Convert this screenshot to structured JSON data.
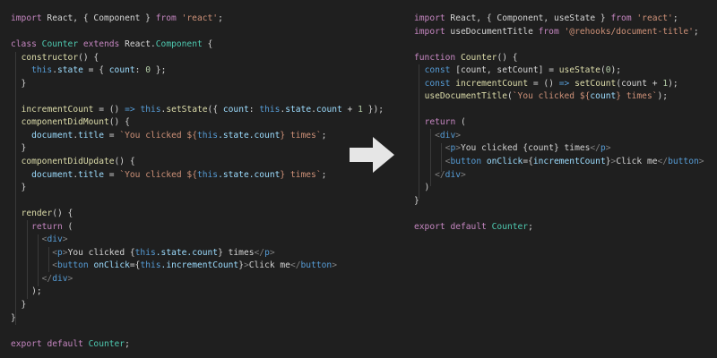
{
  "left_code": {
    "lines": [
      [
        {
          "t": "import",
          "c": "kw"
        },
        {
          "t": " React, { Component } "
        },
        {
          "t": "from",
          "c": "kw"
        },
        {
          "t": " "
        },
        {
          "t": "'react'",
          "c": "st"
        },
        {
          "t": ";"
        }
      ],
      [],
      [
        {
          "t": "class",
          "c": "kw"
        },
        {
          "t": " "
        },
        {
          "t": "Counter",
          "c": "cls"
        },
        {
          "t": " "
        },
        {
          "t": "extends",
          "c": "kw"
        },
        {
          "t": " React."
        },
        {
          "t": "Component",
          "c": "cls"
        },
        {
          "t": " {"
        }
      ],
      [
        {
          "t": "  "
        },
        {
          "t": "constructor",
          "c": "fn"
        },
        {
          "t": "() {"
        }
      ],
      [
        {
          "t": "    "
        },
        {
          "t": "this",
          "c": "th"
        },
        {
          "t": "."
        },
        {
          "t": "state",
          "c": "var"
        },
        {
          "t": " = { "
        },
        {
          "t": "count",
          "c": "var"
        },
        {
          "t": ": "
        },
        {
          "t": "0",
          "c": "num"
        },
        {
          "t": " };"
        }
      ],
      [
        {
          "t": "  }"
        }
      ],
      [],
      [
        {
          "t": "  "
        },
        {
          "t": "incrementCount",
          "c": "fn"
        },
        {
          "t": " = () "
        },
        {
          "t": "=>",
          "c": "th"
        },
        {
          "t": " "
        },
        {
          "t": "this",
          "c": "th"
        },
        {
          "t": "."
        },
        {
          "t": "setState",
          "c": "fn"
        },
        {
          "t": "({ "
        },
        {
          "t": "count",
          "c": "var"
        },
        {
          "t": ": "
        },
        {
          "t": "this",
          "c": "th"
        },
        {
          "t": "."
        },
        {
          "t": "state",
          "c": "var"
        },
        {
          "t": "."
        },
        {
          "t": "count",
          "c": "var"
        },
        {
          "t": " + "
        },
        {
          "t": "1",
          "c": "num"
        },
        {
          "t": " });"
        }
      ],
      [
        {
          "t": "  "
        },
        {
          "t": "componentDidMount",
          "c": "fn"
        },
        {
          "t": "() {"
        }
      ],
      [
        {
          "t": "    "
        },
        {
          "t": "document",
          "c": "var"
        },
        {
          "t": "."
        },
        {
          "t": "title",
          "c": "var"
        },
        {
          "t": " = "
        },
        {
          "t": "`You clicked ${",
          "c": "st"
        },
        {
          "t": "this",
          "c": "th"
        },
        {
          "t": ".state.count",
          "c": "var"
        },
        {
          "t": "} times`",
          "c": "st"
        },
        {
          "t": ";"
        }
      ],
      [
        {
          "t": "  }"
        }
      ],
      [
        {
          "t": "  "
        },
        {
          "t": "componentDidUpdate",
          "c": "fn"
        },
        {
          "t": "() {"
        }
      ],
      [
        {
          "t": "    "
        },
        {
          "t": "document",
          "c": "var"
        },
        {
          "t": "."
        },
        {
          "t": "title",
          "c": "var"
        },
        {
          "t": " = "
        },
        {
          "t": "`You clicked ${",
          "c": "st"
        },
        {
          "t": "this",
          "c": "th"
        },
        {
          "t": ".state.count",
          "c": "var"
        },
        {
          "t": "} times`",
          "c": "st"
        },
        {
          "t": ";"
        }
      ],
      [
        {
          "t": "  }"
        }
      ],
      [],
      [
        {
          "t": "  "
        },
        {
          "t": "render",
          "c": "fn"
        },
        {
          "t": "() {"
        }
      ],
      [
        {
          "t": "    "
        },
        {
          "t": "return",
          "c": "kw"
        },
        {
          "t": " ("
        }
      ],
      [
        {
          "t": "      "
        },
        {
          "t": "<",
          "c": "br"
        },
        {
          "t": "div",
          "c": "tag"
        },
        {
          "t": ">",
          "c": "br"
        }
      ],
      [
        {
          "t": "        "
        },
        {
          "t": "<",
          "c": "br"
        },
        {
          "t": "p",
          "c": "tag"
        },
        {
          "t": ">",
          "c": "br"
        },
        {
          "t": "You clicked {"
        },
        {
          "t": "this",
          "c": "th"
        },
        {
          "t": ".state.count",
          "c": "var"
        },
        {
          "t": "} times"
        },
        {
          "t": "</",
          "c": "br"
        },
        {
          "t": "p",
          "c": "tag"
        },
        {
          "t": ">",
          "c": "br"
        }
      ],
      [
        {
          "t": "        "
        },
        {
          "t": "<",
          "c": "br"
        },
        {
          "t": "button",
          "c": "tag"
        },
        {
          "t": " "
        },
        {
          "t": "onClick",
          "c": "var"
        },
        {
          "t": "={"
        },
        {
          "t": "this",
          "c": "th"
        },
        {
          "t": ".incrementCount",
          "c": "var"
        },
        {
          "t": "}"
        },
        {
          "t": ">",
          "c": "br"
        },
        {
          "t": "Click me"
        },
        {
          "t": "</",
          "c": "br"
        },
        {
          "t": "button",
          "c": "tag"
        },
        {
          "t": ">",
          "c": "br"
        }
      ],
      [
        {
          "t": "      "
        },
        {
          "t": "</",
          "c": "br"
        },
        {
          "t": "div",
          "c": "tag"
        },
        {
          "t": ">",
          "c": "br"
        }
      ],
      [
        {
          "t": "    );"
        }
      ],
      [
        {
          "t": "  }"
        }
      ],
      [
        {
          "t": "}"
        }
      ],
      [],
      [
        {
          "t": "export",
          "c": "kw"
        },
        {
          "t": " "
        },
        {
          "t": "default",
          "c": "kw"
        },
        {
          "t": " "
        },
        {
          "t": "Counter",
          "c": "cls"
        },
        {
          "t": ";"
        }
      ]
    ]
  },
  "right_code": {
    "lines": [
      [
        {
          "t": "import",
          "c": "kw"
        },
        {
          "t": " React, { Component, useState } "
        },
        {
          "t": "from",
          "c": "kw"
        },
        {
          "t": " "
        },
        {
          "t": "'react'",
          "c": "st"
        },
        {
          "t": ";"
        }
      ],
      [
        {
          "t": "import",
          "c": "kw"
        },
        {
          "t": " useDocumentTitle "
        },
        {
          "t": "from",
          "c": "kw"
        },
        {
          "t": " "
        },
        {
          "t": "'@rehooks/document-title'",
          "c": "st"
        },
        {
          "t": ";"
        }
      ],
      [],
      [
        {
          "t": "function",
          "c": "kw"
        },
        {
          "t": " "
        },
        {
          "t": "Counter",
          "c": "fn"
        },
        {
          "t": "() {"
        }
      ],
      [
        {
          "t": "  "
        },
        {
          "t": "const",
          "c": "tag"
        },
        {
          "t": " [count, setCount] = "
        },
        {
          "t": "useState",
          "c": "fn"
        },
        {
          "t": "("
        },
        {
          "t": "0",
          "c": "num"
        },
        {
          "t": ");"
        }
      ],
      [
        {
          "t": "  "
        },
        {
          "t": "const",
          "c": "tag"
        },
        {
          "t": " "
        },
        {
          "t": "incrementCount",
          "c": "fn"
        },
        {
          "t": " = () "
        },
        {
          "t": "=>",
          "c": "th"
        },
        {
          "t": " "
        },
        {
          "t": "setCount",
          "c": "fn"
        },
        {
          "t": "(count + "
        },
        {
          "t": "1",
          "c": "num"
        },
        {
          "t": ");"
        }
      ],
      [
        {
          "t": "  "
        },
        {
          "t": "useDocumentTitle",
          "c": "fn"
        },
        {
          "t": "("
        },
        {
          "t": "`You clicked ${",
          "c": "st"
        },
        {
          "t": "count",
          "c": "var"
        },
        {
          "t": "} times`",
          "c": "st"
        },
        {
          "t": ");"
        }
      ],
      [],
      [
        {
          "t": "  "
        },
        {
          "t": "return",
          "c": "kw"
        },
        {
          "t": " ("
        }
      ],
      [
        {
          "t": "    "
        },
        {
          "t": "<",
          "c": "br"
        },
        {
          "t": "div",
          "c": "tag"
        },
        {
          "t": ">",
          "c": "br"
        }
      ],
      [
        {
          "t": "      "
        },
        {
          "t": "<",
          "c": "br"
        },
        {
          "t": "p",
          "c": "tag"
        },
        {
          "t": ">",
          "c": "br"
        },
        {
          "t": "You clicked {count} times"
        },
        {
          "t": "</",
          "c": "br"
        },
        {
          "t": "p",
          "c": "tag"
        },
        {
          "t": ">",
          "c": "br"
        }
      ],
      [
        {
          "t": "      "
        },
        {
          "t": "<",
          "c": "br"
        },
        {
          "t": "button",
          "c": "tag"
        },
        {
          "t": " "
        },
        {
          "t": "onClick",
          "c": "var"
        },
        {
          "t": "={"
        },
        {
          "t": "incrementCount",
          "c": "var"
        },
        {
          "t": "}"
        },
        {
          "t": ">",
          "c": "br"
        },
        {
          "t": "Click me"
        },
        {
          "t": "</",
          "c": "br"
        },
        {
          "t": "button",
          "c": "tag"
        },
        {
          "t": ">",
          "c": "br"
        }
      ],
      [
        {
          "t": "    "
        },
        {
          "t": "</",
          "c": "br"
        },
        {
          "t": "div",
          "c": "tag"
        },
        {
          "t": ">",
          "c": "br"
        }
      ],
      [
        {
          "t": "  )"
        }
      ],
      [
        {
          "t": "}"
        }
      ],
      [],
      [
        {
          "t": "export",
          "c": "kw"
        },
        {
          "t": " "
        },
        {
          "t": "default",
          "c": "kw"
        },
        {
          "t": " "
        },
        {
          "t": "Counter",
          "c": "cls"
        },
        {
          "t": ";"
        }
      ]
    ]
  },
  "arrow": {
    "icon": "right-arrow-icon",
    "color": "#e6e6e6"
  },
  "colors": {
    "background": "#1f1f1f",
    "keyword": "#c586c0",
    "string": "#ce9178",
    "function": "#dcdcaa",
    "class": "#4ec9b0",
    "variable": "#9cdcfe",
    "number": "#b5cea8",
    "tag": "#569cd6"
  }
}
